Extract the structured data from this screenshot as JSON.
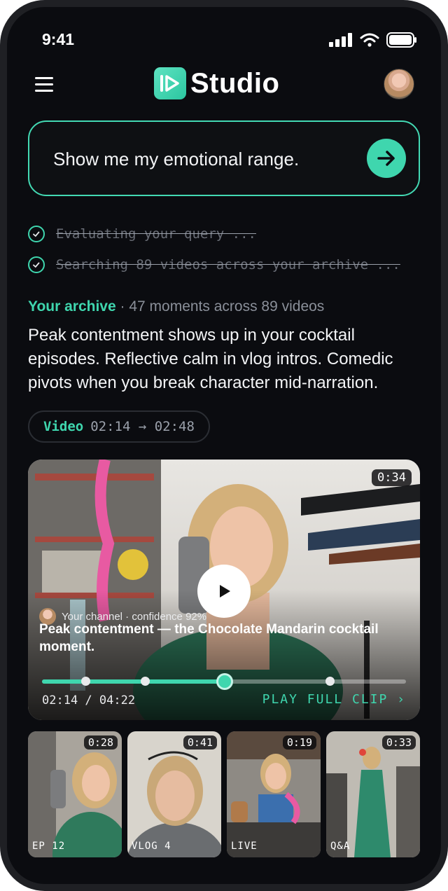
{
  "status_bar": {
    "time": "9:41"
  },
  "header": {
    "brand": "Studio"
  },
  "query": {
    "text": "Show me my emotional range."
  },
  "steps": [
    {
      "text": "Evaluating your query ..."
    },
    {
      "text": "Searching 89 videos across your archive ..."
    }
  ],
  "archive": {
    "label": "Your archive",
    "stats": " · 47 moments across 89 videos",
    "summary": "Peak contentment shows up in your cocktail episodes. Reflective calm in vlog intros. Comedic pivots when you break character mid-narration."
  },
  "video_chip": {
    "label": "Video",
    "range": "02:14 → 02:48"
  },
  "player": {
    "duration": "0:34",
    "meta": "Your channel · confidence 92%",
    "title": "Peak contentment — the Chocolate Mandarin cocktail moment.",
    "progress": 0.502,
    "markers": [
      0.12,
      0.282,
      0.79
    ],
    "time": "02:14 / 04:22",
    "play_full": "PLAY FULL CLIP ›"
  },
  "thumbnails": [
    {
      "duration": "0:28",
      "label": "EP 12"
    },
    {
      "duration": "0:41",
      "label": "VLOG 4"
    },
    {
      "duration": "0:19",
      "label": "LIVE"
    },
    {
      "duration": "0:33",
      "label": "Q&A"
    }
  ],
  "colors": {
    "accent": "#3fd6ae",
    "background": "#0b0c10"
  },
  "icons": [
    "menu-icon",
    "signal-icon",
    "wifi-icon",
    "battery-icon",
    "arrow-right-icon",
    "check-circle-icon",
    "play-icon"
  ]
}
